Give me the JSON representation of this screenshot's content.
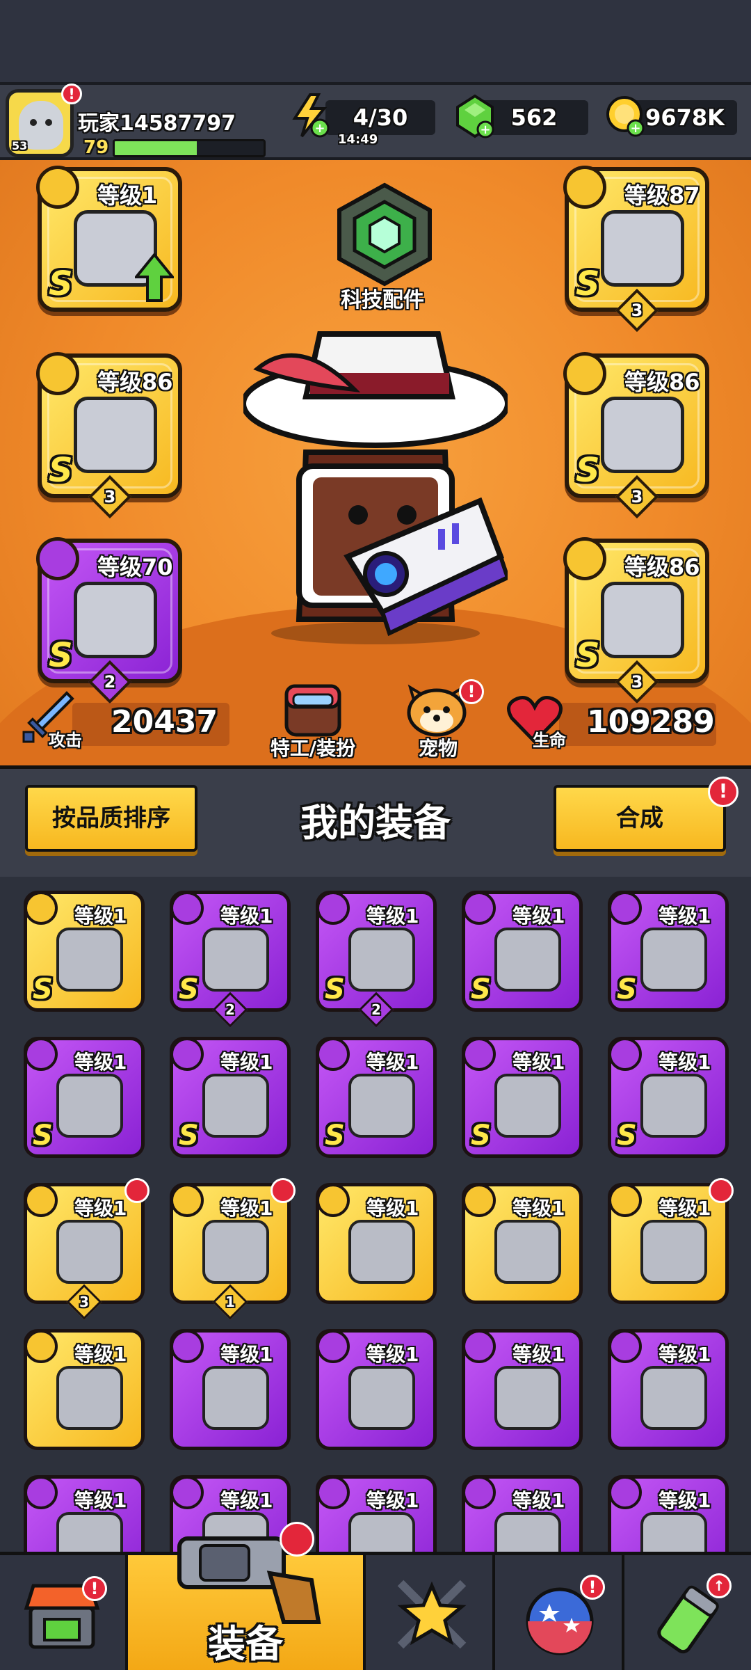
{
  "player": {
    "name": "玩家14587797",
    "level": "79",
    "avatar_level": "53",
    "xp_fraction": 0.55
  },
  "resources": {
    "energy": "4/30",
    "energy_timer": "14:49",
    "gems": "562",
    "coins": "9678K"
  },
  "tech": {
    "label": "科技配件"
  },
  "equipped": [
    {
      "level": "等级1",
      "grade": "S",
      "rarity": "gold",
      "stars": "",
      "icon": "blaster-icon",
      "upgrade": true
    },
    {
      "level": "等级87",
      "grade": "S",
      "rarity": "gold",
      "stars": "3",
      "icon": "armor-icon"
    },
    {
      "level": "等级86",
      "grade": "S",
      "rarity": "gold",
      "stars": "3",
      "icon": "necklace-icon"
    },
    {
      "level": "等级86",
      "grade": "S",
      "rarity": "gold",
      "stars": "3",
      "icon": "belt-icon"
    },
    {
      "level": "等级70",
      "grade": "S",
      "rarity": "purple",
      "stars": "2",
      "icon": "glove-icon"
    },
    {
      "level": "等级86",
      "grade": "S",
      "rarity": "gold",
      "stars": "3",
      "icon": "boot-icon"
    }
  ],
  "stats": {
    "attack_label": "攻击",
    "attack": "20437",
    "hp_label": "生命",
    "hp": "109289"
  },
  "hero_buttons": {
    "agent": "特工/装扮",
    "pet": "宠物"
  },
  "inventory_header": {
    "sort": "按品质排序",
    "title": "我的装备",
    "merge": "合成"
  },
  "inventory": [
    {
      "level": "等级1",
      "grade": "S",
      "rarity": "gold",
      "stars": "",
      "icon": "armor-icon"
    },
    {
      "level": "等级1",
      "grade": "S",
      "rarity": "purple",
      "stars": "2",
      "icon": "armor-icon"
    },
    {
      "level": "等级1",
      "grade": "S",
      "rarity": "purple",
      "stars": "2",
      "icon": "glove-icon"
    },
    {
      "level": "等级1",
      "grade": "S",
      "rarity": "purple",
      "stars": "",
      "icon": "sword-icon"
    },
    {
      "level": "等级1",
      "grade": "S",
      "rarity": "purple",
      "stars": "",
      "icon": "blaster-icon"
    },
    {
      "level": "等级1",
      "grade": "S",
      "rarity": "purple",
      "stars": "",
      "icon": "armor-icon"
    },
    {
      "level": "等级1",
      "grade": "S",
      "rarity": "purple",
      "stars": "",
      "icon": "necklace-icon"
    },
    {
      "level": "等级1",
      "grade": "S",
      "rarity": "purple",
      "stars": "",
      "icon": "belt-icon"
    },
    {
      "level": "等级1",
      "grade": "S",
      "rarity": "purple",
      "stars": "",
      "icon": "belt-icon"
    },
    {
      "level": "等级1",
      "grade": "S",
      "rarity": "purple",
      "stars": "",
      "icon": "boot-icon"
    },
    {
      "level": "等级1",
      "grade": "",
      "rarity": "gold",
      "stars": "3",
      "icon": "kunai-icon",
      "new": true
    },
    {
      "level": "等级1",
      "grade": "",
      "rarity": "gold",
      "stars": "1",
      "icon": "glove-icon",
      "new": true
    },
    {
      "level": "等级1",
      "grade": "",
      "rarity": "gold",
      "stars": "",
      "icon": "kunai-icon"
    },
    {
      "level": "等级1",
      "grade": "",
      "rarity": "gold",
      "stars": "",
      "icon": "necklace-icon"
    },
    {
      "level": "等级1",
      "grade": "",
      "rarity": "gold",
      "stars": "",
      "icon": "glove-icon",
      "new": true
    },
    {
      "level": "等级1",
      "grade": "",
      "rarity": "gold",
      "stars": "",
      "icon": "boot-icon"
    },
    {
      "level": "等级1",
      "grade": "",
      "rarity": "purple",
      "stars": "",
      "icon": "kunai-icon"
    },
    {
      "level": "等级1",
      "grade": "",
      "rarity": "purple",
      "stars": "",
      "icon": "shotgun-icon"
    },
    {
      "level": "等级1",
      "grade": "",
      "rarity": "purple",
      "stars": "",
      "icon": "bat-icon"
    },
    {
      "level": "等级1",
      "grade": "",
      "rarity": "purple",
      "stars": "",
      "icon": "armor-icon"
    },
    {
      "level": "等级1",
      "grade": "",
      "rarity": "purple",
      "stars": "",
      "icon": "armor-icon"
    },
    {
      "level": "等级1",
      "grade": "",
      "rarity": "purple",
      "stars": "",
      "icon": "armor-icon"
    },
    {
      "level": "等级1",
      "grade": "",
      "rarity": "purple",
      "stars": "",
      "icon": "armor-icon"
    },
    {
      "level": "等级1",
      "grade": "",
      "rarity": "purple",
      "stars": "",
      "icon": "necklace-icon"
    },
    {
      "level": "等级1",
      "grade": "",
      "rarity": "purple",
      "stars": "",
      "icon": "necklace-icon"
    }
  ],
  "nav": {
    "equip_label": "装备"
  },
  "colors": {
    "gold": "#f7b820",
    "purple": "#8a22d4",
    "orange_bg": "#f08a2a",
    "alert": "#e3263a"
  }
}
